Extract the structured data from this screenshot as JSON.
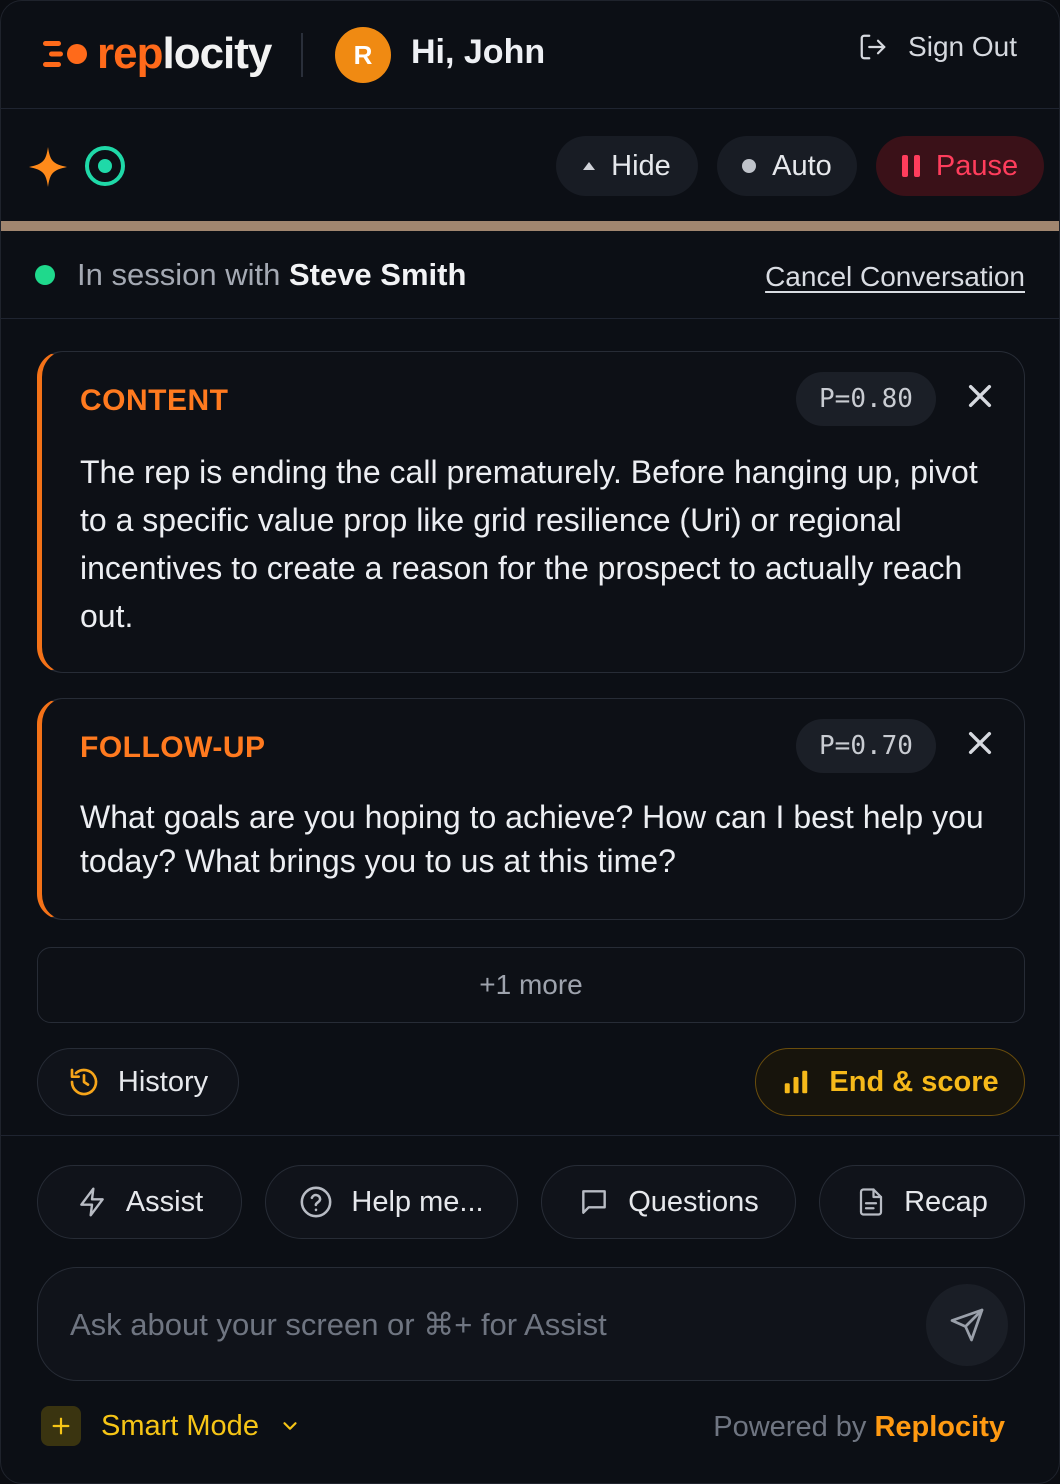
{
  "header": {
    "logo_prefix": "rep",
    "logo_suffix": "locity",
    "avatar_initial": "R",
    "greeting": "Hi, John",
    "sign_out": "Sign Out"
  },
  "toolbar": {
    "hide": "Hide",
    "auto": "Auto",
    "pause": "Pause"
  },
  "session": {
    "prefix": "In session with",
    "name": "Steve Smith",
    "cancel": "Cancel Conversation"
  },
  "cards": [
    {
      "tag": "CONTENT",
      "probability": "P=0.80",
      "body": "The rep is ending the call prematurely. Before hanging up, pivot to a specific value prop like grid resilience (Uri) or regional incentives to create a reason for the prospect to actually reach out."
    },
    {
      "tag": "FOLLOW-UP",
      "probability": "P=0.70",
      "body": "What goals are you hoping to achieve? How can I best help you today? What brings you to us at this time?"
    }
  ],
  "more": "+1 more",
  "actions": {
    "history": "History",
    "end_score": "End & score"
  },
  "quick_actions": {
    "assist": "Assist",
    "help": "Help me...",
    "questions": "Questions",
    "recap": "Recap"
  },
  "input": {
    "placeholder": "Ask about your screen or ⌘+ for Assist"
  },
  "footer": {
    "smart_mode": "Smart Mode",
    "powered_prefix": "Powered by",
    "powered_brand": "Replocity"
  },
  "colors": {
    "accent": "#ff6a1a",
    "success": "#1fd98c",
    "danger": "#ff3d5c",
    "gold": "#f6b91a"
  }
}
